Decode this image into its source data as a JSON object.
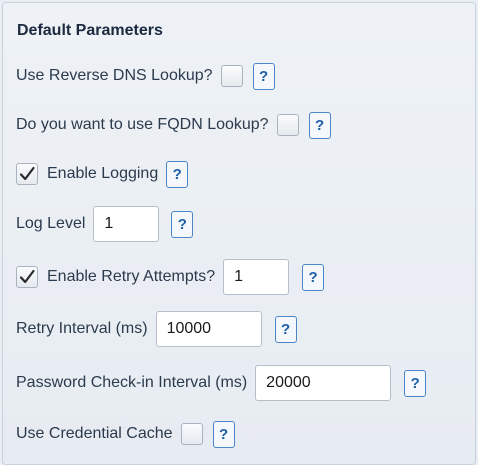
{
  "section": {
    "title": "Default Parameters"
  },
  "fields": {
    "reverse_dns": {
      "label": "Use Reverse DNS Lookup?",
      "checked": false
    },
    "fqdn": {
      "label": "Do you want to use FQDN Lookup?",
      "checked": false
    },
    "logging": {
      "label": "Enable Logging",
      "checked": true
    },
    "log_level": {
      "label": "Log Level",
      "value": "1"
    },
    "retry": {
      "label": "Enable Retry Attempts?",
      "checked": true,
      "value": "1"
    },
    "retry_interval": {
      "label": "Retry Interval (ms)",
      "value": "10000"
    },
    "password_checkin": {
      "label": "Password Check-in Interval (ms)",
      "value": "20000"
    },
    "credential_cache": {
      "label": "Use Credential Cache",
      "checked": false
    }
  },
  "help_button": {
    "label": "?"
  },
  "colors": {
    "help_border": "#4a86c8",
    "help_text": "#1d5ea8",
    "text": "#2b3a4d",
    "panel_bg": "#e9eef4"
  }
}
